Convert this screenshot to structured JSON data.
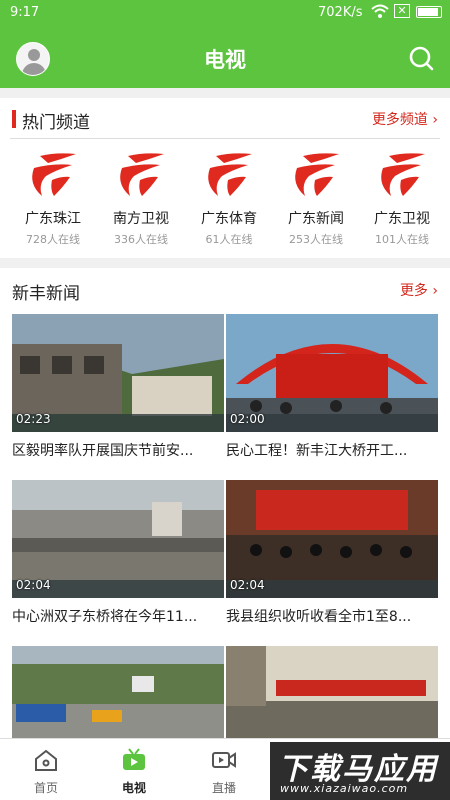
{
  "status_bar": {
    "time": "9:17",
    "net_speed": "702K/s",
    "battery_x": "✕"
  },
  "header": {
    "title": "电视"
  },
  "hot_channels": {
    "title": "热门频道",
    "more_label": "更多频道 ›",
    "channels": [
      {
        "name": "广东珠江",
        "viewers": "728人在线"
      },
      {
        "name": "南方卫视",
        "viewers": "336人在线"
      },
      {
        "name": "广东体育",
        "viewers": "61人在线"
      },
      {
        "name": "广东新闻",
        "viewers": "253人在线"
      },
      {
        "name": "广东卫视",
        "viewers": "101人在线"
      }
    ]
  },
  "news": {
    "title": "新丰新闻",
    "more_label": "更多 ›",
    "items": [
      {
        "duration": "02:23",
        "caption": "区毅明率队开展国庆节前安..."
      },
      {
        "duration": "02:00",
        "caption": "民心工程！新丰江大桥开工..."
      },
      {
        "duration": "02:04",
        "caption": "中心洲双子东桥将在今年11..."
      },
      {
        "duration": "02:04",
        "caption": "我县组织收听收看全市1至8..."
      },
      {
        "duration": "",
        "caption": ""
      },
      {
        "duration": "",
        "caption": ""
      }
    ]
  },
  "tabs": [
    {
      "label": "首页",
      "active": false
    },
    {
      "label": "电视",
      "active": true
    },
    {
      "label": "直播",
      "active": false
    }
  ],
  "watermark": {
    "main": "下载马应用",
    "sub": "www.xiazaiwao.com"
  },
  "colors": {
    "brand_green": "#5cc43e",
    "accent_red": "#e02a1f"
  }
}
